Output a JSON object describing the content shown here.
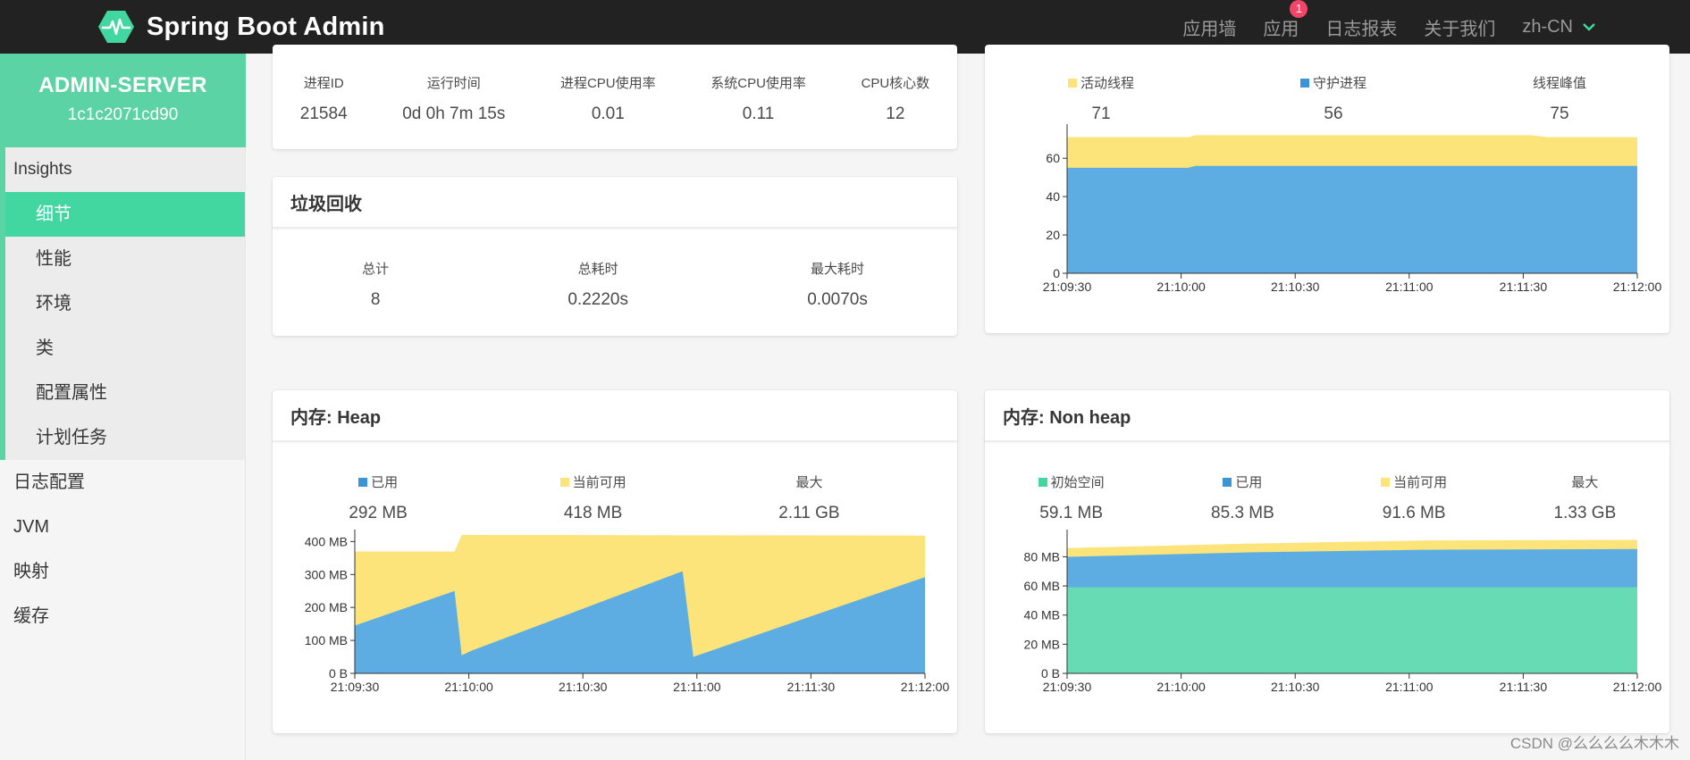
{
  "navbar": {
    "brand": "Spring Boot Admin",
    "items": [
      {
        "label": "应用墙"
      },
      {
        "label": "应用",
        "badge": "1"
      },
      {
        "label": "日志报表"
      },
      {
        "label": "关于我们"
      },
      {
        "label": "zh-CN"
      }
    ]
  },
  "sidebar": {
    "app_name": "ADMIN-SERVER",
    "app_id": "1c1c2071cd90",
    "group_title": "Insights",
    "sub_items": [
      "细节",
      "性能",
      "环境",
      "类",
      "配置属性",
      "计划任务"
    ],
    "items": [
      "日志配置",
      "JVM",
      "映射",
      "缓存"
    ]
  },
  "process": {
    "labels": [
      "进程ID",
      "运行时间",
      "进程CPU使用率",
      "系统CPU使用率",
      "CPU核心数"
    ],
    "values": [
      "21584",
      "0d 0h 7m 15s",
      "0.01",
      "0.11",
      "12"
    ]
  },
  "gc": {
    "title": "垃圾回收",
    "labels": [
      "总计",
      "总耗时",
      "最大耗时"
    ],
    "values": [
      "8",
      "0.2220s",
      "0.0070s"
    ]
  },
  "threads": {
    "labels": [
      "活动线程",
      "守护进程",
      "线程峰值"
    ],
    "values": [
      "71",
      "56",
      "75"
    ]
  },
  "heap": {
    "title": "内存: Heap",
    "labels": [
      "已用",
      "当前可用",
      "最大"
    ],
    "values": [
      "292 MB",
      "418 MB",
      "2.11 GB"
    ]
  },
  "nonheap": {
    "title": "内存: Non heap",
    "labels": [
      "初始空间",
      "已用",
      "当前可用",
      "最大"
    ],
    "values": [
      "59.1 MB",
      "85.3 MB",
      "91.6 MB",
      "1.33 GB"
    ]
  },
  "colors": {
    "accent": "#42d6a0",
    "used": "#5dade2",
    "available": "#fce37a",
    "init": "#67dcb4"
  },
  "chart_data": [
    {
      "type": "area",
      "name": "threads",
      "x": [
        "21:09:30",
        "21:10:00",
        "21:10:30",
        "21:11:00",
        "21:11:30",
        "21:12:00"
      ],
      "ylim": [
        0,
        75
      ],
      "yticks": [
        0,
        20,
        40,
        60
      ],
      "series": [
        {
          "name": "守护进程",
          "color": "#5dade2",
          "points": [
            [
              0,
              55
            ],
            [
              34,
              55
            ],
            [
              36,
              56
            ],
            [
              135,
              56
            ],
            [
              150,
              56
            ],
            [
              158,
              56
            ],
            [
              160,
              56
            ]
          ]
        },
        {
          "name": "活动线程",
          "color": "#fce37a",
          "points": [
            [
              0,
              71
            ],
            [
              34,
              71
            ],
            [
              36,
              72
            ],
            [
              130,
              72
            ],
            [
              135,
              71
            ],
            [
              150,
              71
            ],
            [
              160,
              71
            ]
          ]
        }
      ],
      "xrange": [
        0,
        160
      ]
    },
    {
      "type": "area",
      "name": "heap",
      "x": [
        "21:09:30",
        "21:10:00",
        "21:10:30",
        "21:11:00",
        "21:11:30",
        "21:12:00"
      ],
      "ylim": [
        0,
        420
      ],
      "yticks": [
        [
          0,
          "0 B"
        ],
        [
          100,
          "100 MB"
        ],
        [
          200,
          "200 MB"
        ],
        [
          300,
          "300 MB"
        ],
        [
          400,
          "400 MB"
        ]
      ],
      "series": [
        {
          "name": "已用",
          "color": "#5dade2",
          "points": [
            [
              0,
              145
            ],
            [
              28,
              250
            ],
            [
              30,
              55
            ],
            [
              33,
              70
            ],
            [
              92,
              310
            ],
            [
              95,
              50
            ],
            [
              160,
              292
            ]
          ]
        },
        {
          "name": "当前可用",
          "color": "#fce37a",
          "points": [
            [
              0,
              370
            ],
            [
              28,
              370
            ],
            [
              30,
              420
            ],
            [
              160,
              418
            ]
          ]
        }
      ],
      "xrange": [
        0,
        160
      ]
    },
    {
      "type": "area",
      "name": "nonheap",
      "x": [
        "21:09:30",
        "21:10:00",
        "21:10:30",
        "21:11:00",
        "21:11:30",
        "21:12:00"
      ],
      "ylim": [
        0,
        95
      ],
      "yticks": [
        [
          0,
          "0 B"
        ],
        [
          20,
          "20 MB"
        ],
        [
          40,
          "40 MB"
        ],
        [
          60,
          "60 MB"
        ],
        [
          80,
          "80 MB"
        ]
      ],
      "series": [
        {
          "name": "初始空间",
          "color": "#67dcb4",
          "points": [
            [
              0,
              59.1
            ],
            [
              160,
              59.1
            ]
          ]
        },
        {
          "name": "已用",
          "color": "#5dade2",
          "points": [
            [
              0,
              80
            ],
            [
              50,
              83
            ],
            [
              100,
              84.8
            ],
            [
              160,
              85.3
            ]
          ]
        },
        {
          "name": "当前可用",
          "color": "#fce37a",
          "points": [
            [
              0,
              86
            ],
            [
              50,
              89
            ],
            [
              100,
              91.2
            ],
            [
              160,
              91.6
            ]
          ]
        }
      ],
      "xrange": [
        0,
        160
      ]
    }
  ],
  "watermark": "CSDN @么么么么木木木"
}
